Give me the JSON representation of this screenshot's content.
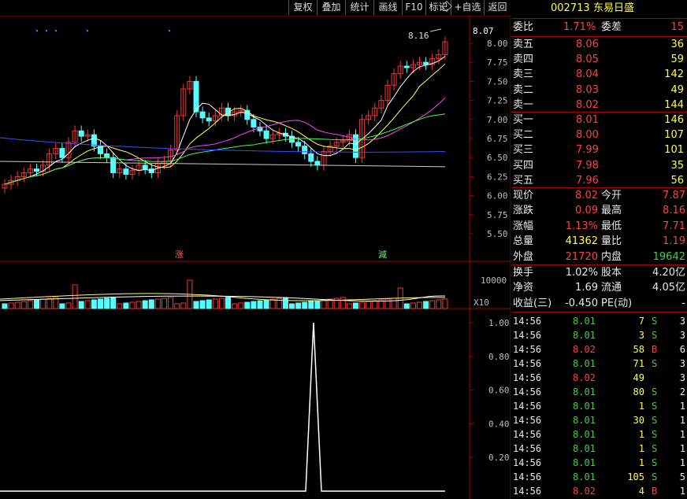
{
  "toolbar": {
    "items": [
      "复权",
      "叠加",
      "统计",
      "画线",
      "F10",
      "标记",
      "+自选",
      "返回"
    ]
  },
  "chart": {
    "price_ticks": [
      "8.00",
      "7.75",
      "7.50",
      "7.25",
      "7.00",
      "6.75",
      "6.50",
      "6.25",
      "6.00",
      "5.75",
      "5.50"
    ],
    "current_price_tag": "8.07",
    "high_marker": "8.16",
    "rise_tag": "涨",
    "cut_tag": "減",
    "volume_tick": "10000",
    "volume_unit": "X10",
    "indicator_ticks": [
      "1.00",
      "0.80",
      "0.60",
      "0.40",
      "0.20"
    ]
  },
  "stock": {
    "code": "002713",
    "name": "东易日盛"
  },
  "ratio": {
    "label": "委比",
    "value": "1.71%",
    "diff_label": "委差",
    "diff_value": "15"
  },
  "asks": [
    {
      "label": "卖五",
      "price": "8.06",
      "vol": "36"
    },
    {
      "label": "卖四",
      "price": "8.05",
      "vol": "59"
    },
    {
      "label": "卖三",
      "price": "8.04",
      "vol": "142"
    },
    {
      "label": "卖二",
      "price": "8.03",
      "vol": "49"
    },
    {
      "label": "卖一",
      "price": "8.02",
      "vol": "144"
    }
  ],
  "bids": [
    {
      "label": "买一",
      "price": "8.01",
      "vol": "146"
    },
    {
      "label": "买二",
      "price": "8.00",
      "vol": "107"
    },
    {
      "label": "买三",
      "price": "7.99",
      "vol": "101"
    },
    {
      "label": "买四",
      "price": "7.98",
      "vol": "35"
    },
    {
      "label": "买五",
      "price": "7.96",
      "vol": "56"
    }
  ],
  "quote": [
    {
      "l1": "现价",
      "v1": "8.02",
      "c1": "red",
      "l2": "今开",
      "v2": "7.87",
      "c2": "red"
    },
    {
      "l1": "涨跌",
      "v1": "0.09",
      "c1": "red",
      "l2": "最高",
      "v2": "8.16",
      "c2": "red"
    },
    {
      "l1": "涨幅",
      "v1": "1.13%",
      "c1": "red",
      "l2": "最低",
      "v2": "7.71",
      "c2": "red"
    },
    {
      "l1": "总量",
      "v1": "41362",
      "c1": "yel",
      "l2": "量比",
      "v2": "1.19",
      "c2": "red"
    },
    {
      "l1": "外盘",
      "v1": "21720",
      "c1": "red",
      "l2": "内盘",
      "v2": "19642",
      "c2": "grn"
    }
  ],
  "fund": [
    {
      "l1": "换手",
      "v1": "1.02%",
      "l2": "股本",
      "v2": "4.20亿"
    },
    {
      "l1": "净资",
      "v1": "1.69",
      "l2": "流通",
      "v2": "4.05亿"
    },
    {
      "l1": "收益(三)",
      "v1": "-0.450",
      "l2": "PE(动)",
      "v2": "-"
    }
  ],
  "ticks": [
    {
      "t": "14:56",
      "p": "8.01",
      "pc": "grn",
      "v": "7",
      "vc": "yel",
      "s": "S",
      "n": "3"
    },
    {
      "t": "14:56",
      "p": "8.01",
      "pc": "grn",
      "v": "3",
      "vc": "yel",
      "s": "S",
      "n": "3"
    },
    {
      "t": "14:56",
      "p": "8.02",
      "pc": "red",
      "v": "58",
      "vc": "yel",
      "s": "B",
      "n": "6"
    },
    {
      "t": "14:56",
      "p": "8.01",
      "pc": "grn",
      "v": "71",
      "vc": "yel",
      "s": "S",
      "n": "3"
    },
    {
      "t": "14:56",
      "p": "8.02",
      "pc": "red",
      "v": "49",
      "vc": "yel",
      "s": "",
      "n": "3"
    },
    {
      "t": "14:56",
      "p": "8.01",
      "pc": "grn",
      "v": "80",
      "vc": "yel",
      "s": "S",
      "n": "2"
    },
    {
      "t": "14:56",
      "p": "8.01",
      "pc": "grn",
      "v": "1",
      "vc": "yel",
      "s": "S",
      "n": "1"
    },
    {
      "t": "14:56",
      "p": "8.01",
      "pc": "grn",
      "v": "30",
      "vc": "yel",
      "s": "S",
      "n": "1"
    },
    {
      "t": "14:56",
      "p": "8.01",
      "pc": "grn",
      "v": "1",
      "vc": "yel",
      "s": "S",
      "n": "1"
    },
    {
      "t": "14:56",
      "p": "8.01",
      "pc": "grn",
      "v": "1",
      "vc": "yel",
      "s": "S",
      "n": "1"
    },
    {
      "t": "14:56",
      "p": "8.01",
      "pc": "grn",
      "v": "1",
      "vc": "yel",
      "s": "S",
      "n": "1"
    },
    {
      "t": "14:56",
      "p": "8.01",
      "pc": "grn",
      "v": "105",
      "vc": "yel",
      "s": "S",
      "n": "5"
    },
    {
      "t": "14:56",
      "p": "8.02",
      "pc": "red",
      "v": "4",
      "vc": "yel",
      "s": "B",
      "n": "1"
    }
  ],
  "colors": {
    "up": "#ff3232",
    "down": "#54ffff",
    "panel_line": "#a00000"
  }
}
